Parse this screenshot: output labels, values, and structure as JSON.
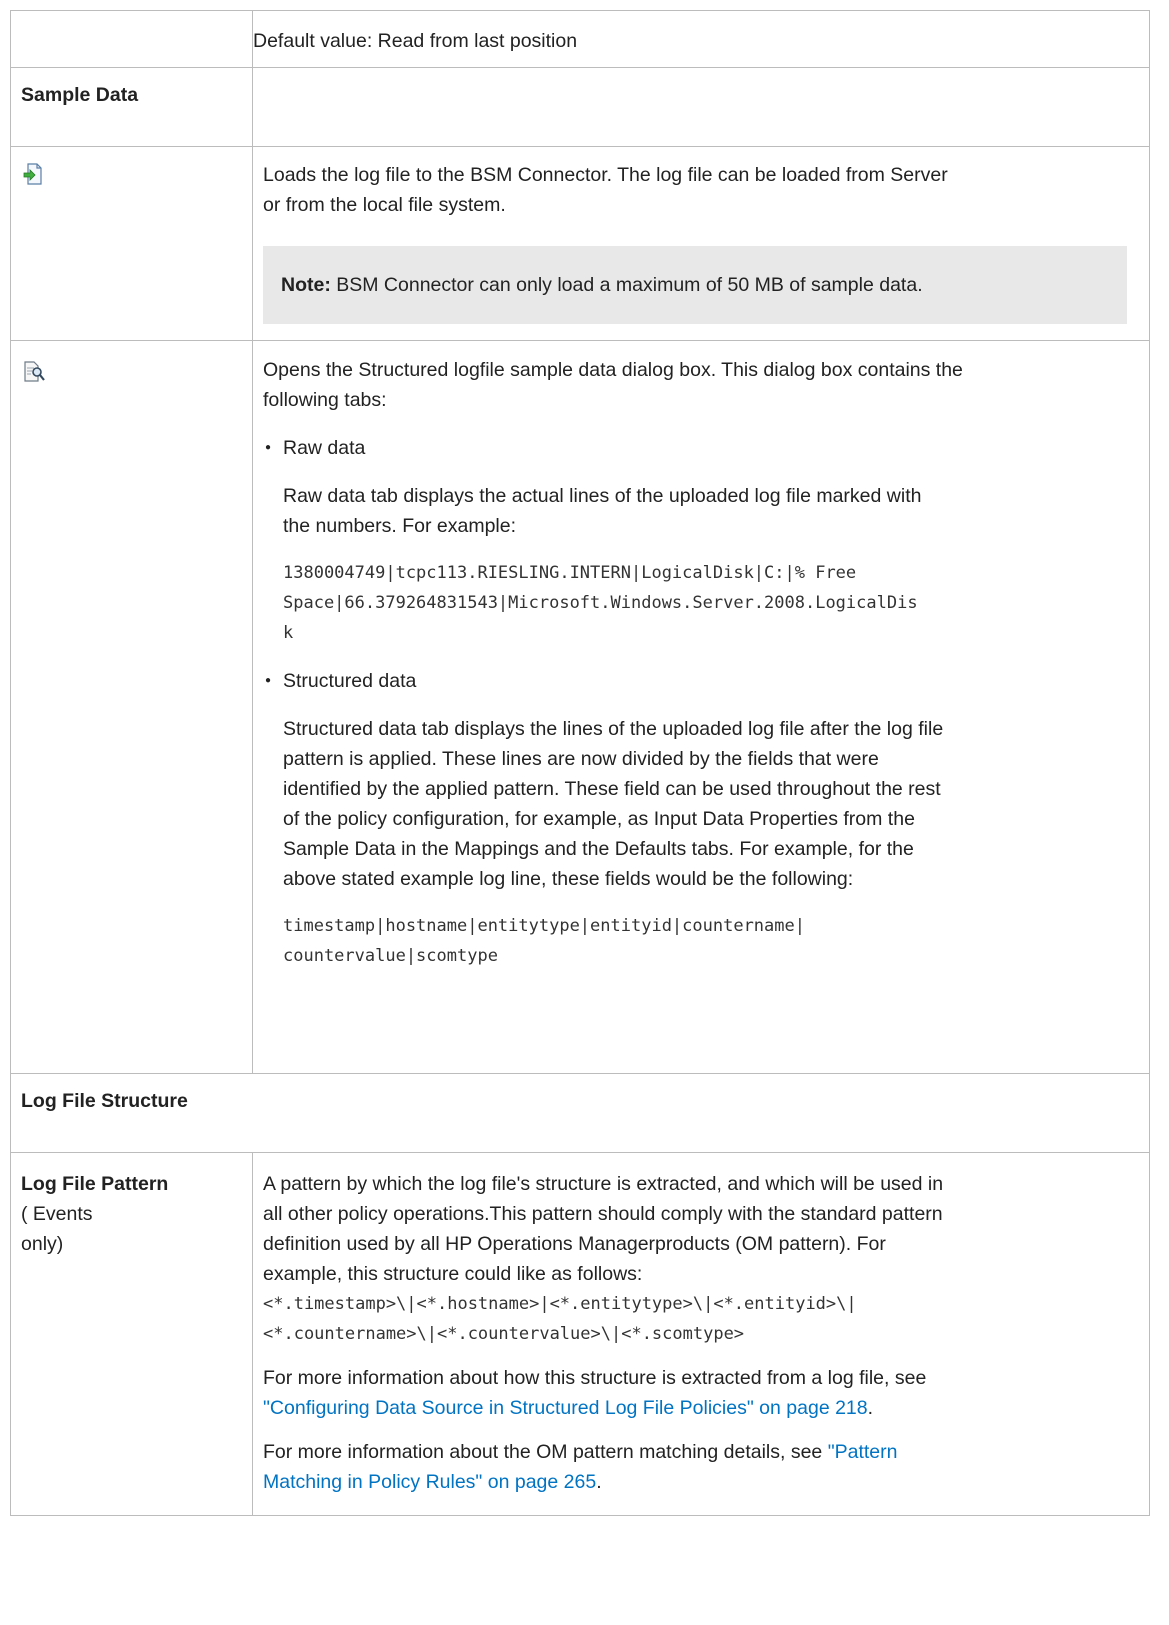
{
  "row_default": {
    "text": "Default value: Read from last position"
  },
  "section_sample": {
    "heading": "Sample Data"
  },
  "load_row": {
    "icon": "load-file-icon",
    "description_1": "Loads the log file to the BSM Connector. The log file can be loaded from Server",
    "description_2": "or from the local file system.",
    "note_label": "Note:",
    "note_text": " BSM Connector can only load a maximum of 50 MB of sample data."
  },
  "open_row": {
    "icon": "sample-data-icon",
    "intro_1": "Opens the Structured logfile sample data dialog box. This dialog box contains the",
    "intro_2": "following tabs:",
    "raw_title": "Raw data",
    "raw_desc_1": "Raw data tab displays the actual lines of the uploaded log file marked with",
    "raw_desc_2": "the numbers. For example:",
    "raw_example_1": "1380004749|tcpc113.RIESLING.INTERN|LogicalDisk|C:|% Free",
    "raw_example_2": "Space|66.379264831543|Microsoft.Windows.Server.2008.LogicalDis",
    "raw_example_3": "k",
    "struct_title": "Structured data",
    "struct_desc_1": "Structured data tab displays the lines of the uploaded log file after the log file",
    "struct_desc_2": "pattern is applied. These lines are now divided by the fields that were",
    "struct_desc_3": "identified by the applied pattern. These field can be used throughout the rest",
    "struct_desc_4": "of the policy configuration, for example, as Input Data Properties from the",
    "struct_desc_5": "Sample Data in the Mappings and the Defaults tabs. For example, for the",
    "struct_desc_6": "above stated example log line, these fields would be the following:",
    "struct_example_1": "timestamp|hostname|entitytype|entityid|countername|",
    "struct_example_2": "countervalue|scomtype"
  },
  "section_structure": {
    "heading": "Log File Structure"
  },
  "pattern_row": {
    "label": "Log File Pattern",
    "sub_1": "( Events",
    "sub_2": "only)",
    "desc_1": "A pattern by which the log file's structure is extracted, and which will be used in",
    "desc_2": "all other policy operations.This pattern should comply with the standard pattern",
    "desc_3": "definition used by all HP Operations Managerproducts (OM pattern). For",
    "desc_4": "example, this structure could like as follows:",
    "code_1": "<*.timestamp>\\|<*.hostname>|<*.entitytype>\\|<*.entityid>\\|",
    "code_2": "<*.countername>\\|<*.countervalue>\\|<*.scomtype>",
    "more1_1": "For more information about how this structure is extracted from a log file, see",
    "more1_link": "\"Configuring Data Source in Structured Log File Policies\" on page 218",
    "more1_end": ".",
    "more2_1": "For more information about the OM pattern matching details, see ",
    "more2_link_1": "\"Pattern",
    "more2_link_2": "Matching in Policy Rules\" on page 265",
    "more2_end": "."
  }
}
